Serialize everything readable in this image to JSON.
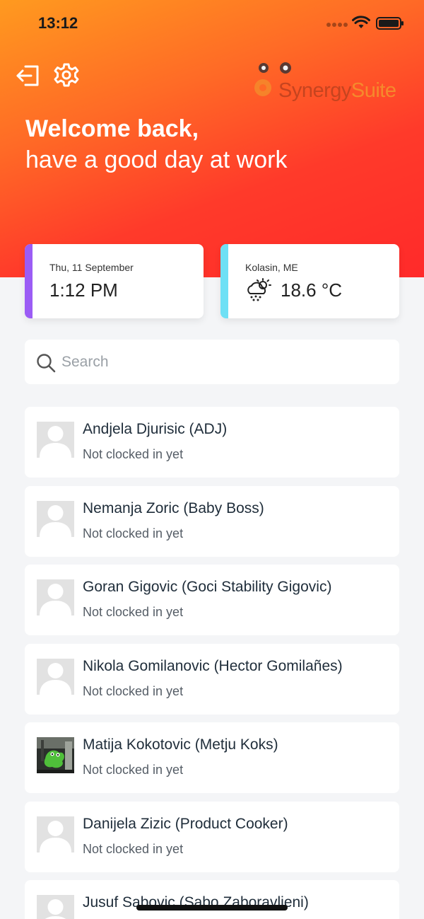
{
  "status_bar": {
    "time": "13:12"
  },
  "header": {
    "logo": {
      "part1": "Synergy",
      "part2": "Suite"
    },
    "welcome_title": "Welcome back,",
    "welcome_subtitle": "have a good day at work"
  },
  "date_card": {
    "date": "Thu, 11 September",
    "time": "1:12 PM"
  },
  "weather_card": {
    "location": "Kolasin, ME",
    "temperature": "18.6 °C",
    "icon": "cloud-sun-snow-icon"
  },
  "search": {
    "placeholder": "Search",
    "value": ""
  },
  "employees": [
    {
      "name": "Andjela Djurisic (ADJ)",
      "status": "Not clocked in yet",
      "avatar": "placeholder"
    },
    {
      "name": "Nemanja Zoric (Baby Boss)",
      "status": "Not clocked in yet",
      "avatar": "placeholder"
    },
    {
      "name": "Goran Gigovic (Goci Stability Gigovic)",
      "status": "Not clocked in yet",
      "avatar": "placeholder"
    },
    {
      "name": "Nikola Gomilanovic (Hector Gomilañes)",
      "status": "Not clocked in yet",
      "avatar": "placeholder"
    },
    {
      "name": "Matija Kokotovic (Metju Koks)",
      "status": "Not clocked in yet",
      "avatar": "photo"
    },
    {
      "name": "Danijela Zizic (Product Cooker)",
      "status": "Not clocked in yet",
      "avatar": "placeholder"
    },
    {
      "name": "Jusuf Sabovic (Sabo Zaboravljeni)",
      "status": "",
      "avatar": "placeholder"
    }
  ],
  "colors": {
    "header_gradient_start": "#ff9a1f",
    "header_gradient_end": "#ff2a2a",
    "date_accent": "#9b5cf5",
    "weather_accent": "#6ee0f5"
  }
}
